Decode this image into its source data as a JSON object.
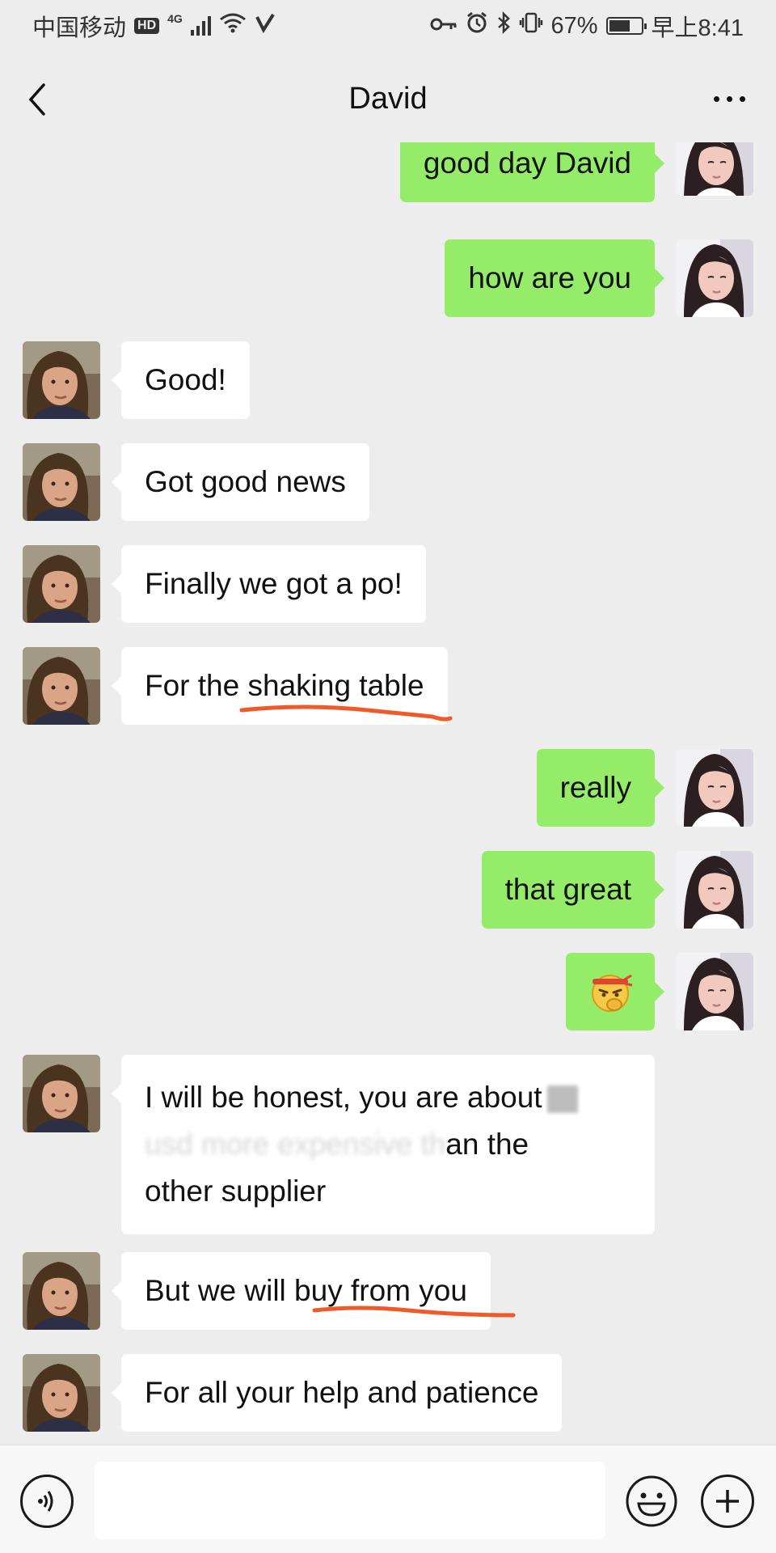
{
  "status_bar": {
    "carrier": "中国移动",
    "hd": "HD",
    "network": "4G",
    "battery_percent": "67%",
    "battery_level": 0.67,
    "time": "早上8:41",
    "icons": [
      "hd-icon",
      "signal-icon",
      "wifi-icon",
      "vpn-icon",
      "key-icon",
      "alarm-icon",
      "bluetooth-icon",
      "vibrate-icon",
      "battery-icon"
    ]
  },
  "nav": {
    "title": "David",
    "back_icon": "chevron-left-icon",
    "more_icon": "more-dots-icon"
  },
  "messages": [
    {
      "side": "right",
      "text": "good day David"
    },
    {
      "side": "right",
      "text": "how are you"
    },
    {
      "side": "left",
      "text": "Good!"
    },
    {
      "side": "left",
      "text": "Got good news"
    },
    {
      "side": "left",
      "text": "Finally we got a po!"
    },
    {
      "side": "left",
      "text": "For the shaking table"
    },
    {
      "side": "right",
      "text": "really"
    },
    {
      "side": "right",
      "text": "that great"
    },
    {
      "side": "right",
      "text": "",
      "emoji": "thinking-fighting-emoji"
    },
    {
      "side": "left",
      "line1": "I will be honest, you are about",
      "line2_blurred": "usd more expensive th",
      "line2_end": "an the",
      "line3": "other supplier"
    },
    {
      "side": "left",
      "text": "But we will buy from you"
    },
    {
      "side": "left",
      "text": "For all your help and patience"
    }
  ],
  "input_bar": {
    "placeholder": "",
    "voice_icon": "voice-icon",
    "emoji_icon": "emoji-icon",
    "plus_icon": "plus-icon"
  },
  "colors": {
    "background": "#ededed",
    "bubble_self": "#95ec69",
    "bubble_other": "#ffffff",
    "annotation": "#f05a28"
  }
}
